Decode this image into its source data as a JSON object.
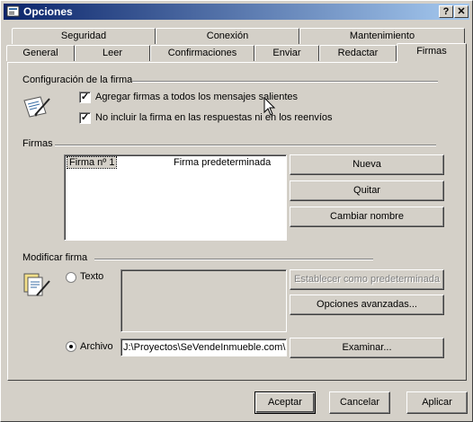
{
  "window": {
    "title": "Opciones",
    "help_label": "?",
    "close_label": "✕"
  },
  "tabs_back": [
    {
      "label": "Seguridad"
    },
    {
      "label": "Conexión"
    },
    {
      "label": "Mantenimiento"
    }
  ],
  "tabs_front": [
    {
      "label": "General"
    },
    {
      "label": "Leer"
    },
    {
      "label": "Confirmaciones"
    },
    {
      "label": "Enviar"
    },
    {
      "label": "Redactar"
    },
    {
      "label": "Firmas",
      "selected": true
    }
  ],
  "config": {
    "heading": "Configuración de la firma",
    "checkbox1": {
      "label": "Agregar firmas a todos los mensajes salientes",
      "checked": true
    },
    "checkbox2": {
      "label": "No incluir la firma en las respuestas ni en los reenvíos",
      "checked": true
    },
    "check_mark": "✓"
  },
  "firmas": {
    "heading": "Firmas",
    "list": [
      {
        "name": "Firma nº 1",
        "status": "Firma predeterminada"
      }
    ],
    "buttons": {
      "new": "Nueva",
      "remove": "Quitar",
      "rename": "Cambiar nombre"
    }
  },
  "modify": {
    "heading": "Modificar firma",
    "text_option": "Texto",
    "file_option": "Archivo",
    "file_path": "J:\\Proyectos\\SeVendeInmueble.com\\",
    "buttons": {
      "set_default": "Establecer como predeterminada",
      "advanced": "Opciones avanzadas...",
      "browse": "Examinar..."
    }
  },
  "footer": {
    "accept": "Aceptar",
    "cancel": "Cancelar",
    "apply": "Aplicar"
  }
}
